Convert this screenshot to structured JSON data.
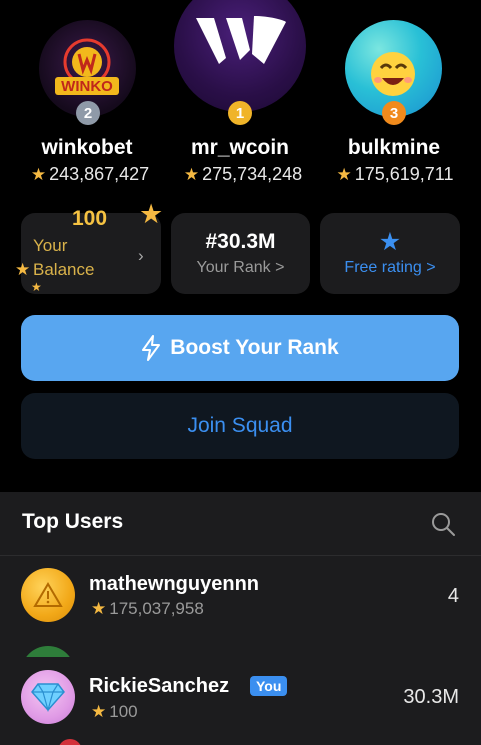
{
  "podium": [
    {
      "rank": "2",
      "name": "winkobet",
      "score": "243,867,427",
      "avatar_text": "WINKO",
      "avatar_icon": "winko-logo"
    },
    {
      "rank": "1",
      "name": "mr_wcoin",
      "score": "275,734,248",
      "avatar_icon": "w-logo"
    },
    {
      "rank": "3",
      "name": "bulkmine",
      "score": "175,619,711",
      "avatar_icon": "smiley-face"
    }
  ],
  "stats": {
    "balance_amount": "100",
    "balance_label": "Your Balance",
    "rank_value": "#30.3M",
    "rank_label": "Your Rank >",
    "free_label": "Free rating >"
  },
  "buttons": {
    "boost": "Boost Your Rank",
    "squad": "Join Squad"
  },
  "top_users": {
    "title": "Top Users",
    "rows": [
      {
        "name": "mathewnguyennn",
        "score": "175,037,958",
        "rank": "4"
      }
    ]
  },
  "current_user": {
    "name": "RickieSanchez",
    "tag": "You",
    "score": "100",
    "rank": "30.3M"
  },
  "colors": {
    "accent_blue": "#3b8ff0",
    "boost_button": "#58a6f0",
    "star_gold": "#f5b942",
    "card_bg": "#1c1c1e"
  }
}
